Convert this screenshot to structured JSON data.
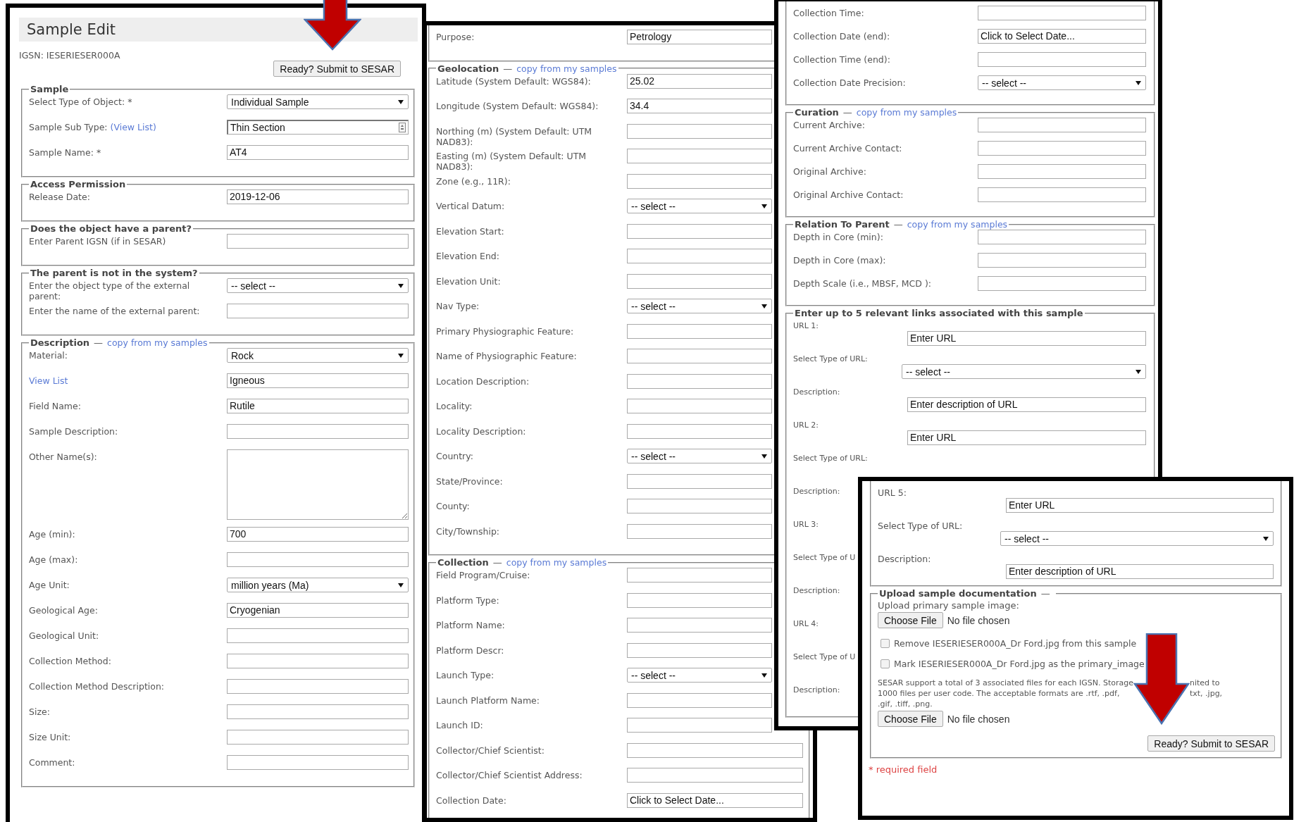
{
  "panels": [
    {
      "title": "Sample Edit",
      "igsn": "IGSN: IESERIESER000A",
      "submit": "Ready? Submit to SESAR",
      "sections": [
        {
          "kind": "form",
          "legend": "Sample",
          "rows": [
            {
              "kind": "select",
              "label": "Select Type of Object: *",
              "value": "Individual Sample"
            },
            {
              "kind": "lookup",
              "label": "Sample Sub Type:",
              "link": "(View List)",
              "value": "Thin Section"
            },
            {
              "kind": "input",
              "label": "Sample Name: *",
              "value": "AT4"
            }
          ]
        },
        {
          "kind": "form",
          "legend": "Access Permission",
          "rows": [
            {
              "kind": "input",
              "label": "Release Date:",
              "value": "2019-12-06"
            }
          ]
        },
        {
          "kind": "form",
          "legend": "Does the object have a parent?",
          "rows": [
            {
              "kind": "input",
              "label": "Enter Parent IGSN (if in SESAR)"
            }
          ]
        },
        {
          "kind": "form",
          "legend": "The parent is not in the system?",
          "rows": [
            {
              "kind": "select",
              "label": "Enter the object type of the external parent:",
              "value": "-- select --"
            },
            {
              "kind": "input",
              "label": "Enter the name of the external parent:"
            }
          ]
        },
        {
          "kind": "form",
          "legend": "Description",
          "separator": "—",
          "copy_link": "copy from my samples",
          "rows": [
            {
              "kind": "select",
              "label": "Material:",
              "value": "Rock"
            },
            {
              "kind": "input",
              "link": "View List",
              "value": "Igneous"
            },
            {
              "kind": "input",
              "label": "Field Name:",
              "value": "Rutile"
            },
            {
              "kind": "input",
              "label": "Sample Description:"
            },
            {
              "kind": "textarea",
              "label": "Other Name(s):"
            },
            {
              "kind": "input",
              "label": "Age (min):",
              "value": "700"
            },
            {
              "kind": "input",
              "label": "Age (max):"
            },
            {
              "kind": "select",
              "label": "Age Unit:",
              "value": "million years (Ma)"
            },
            {
              "kind": "input",
              "label": "Geological Age:",
              "value": "Cryogenian"
            },
            {
              "kind": "input",
              "label": "Geological Unit:"
            },
            {
              "kind": "input",
              "label": "Collection Method:"
            },
            {
              "kind": "input",
              "label": "Collection Method Description:"
            },
            {
              "kind": "input",
              "label": "Size:"
            },
            {
              "kind": "input",
              "label": "Size Unit:"
            },
            {
              "kind": "input",
              "label": "Comment:"
            }
          ]
        }
      ]
    },
    {
      "sections": [
        {
          "kind": "form",
          "rows": [
            {
              "kind": "input",
              "label": "Purpose:",
              "value": "Petrology"
            }
          ]
        },
        {
          "kind": "form",
          "legend": "Geolocation",
          "separator": "—",
          "copy_link": "copy from my samples",
          "rows": [
            {
              "kind": "input",
              "label": "Latitude (System Default: WGS84):",
              "value": "25.02"
            },
            {
              "kind": "input",
              "label": "Longitude (System Default: WGS84):",
              "value": "34.4"
            },
            {
              "kind": "input",
              "label": "Northing (m) (System Default: UTM NAD83):"
            },
            {
              "kind": "input",
              "label": "Easting (m) (System Default: UTM NAD83):"
            },
            {
              "kind": "input",
              "label": "Zone (e.g., 11R):"
            },
            {
              "kind": "select",
              "label": "Vertical Datum:",
              "value": "-- select --"
            },
            {
              "kind": "input",
              "label": "Elevation Start:"
            },
            {
              "kind": "input",
              "label": "Elevation End:"
            },
            {
              "kind": "input",
              "label": "Elevation Unit:"
            },
            {
              "kind": "select",
              "label": "Nav Type:",
              "value": "-- select --"
            },
            {
              "kind": "input",
              "label": "Primary Physiographic Feature:"
            },
            {
              "kind": "input",
              "label": "Name of Physiographic Feature:"
            },
            {
              "kind": "input",
              "label": "Location Description:"
            },
            {
              "kind": "input",
              "label": "Locality:"
            },
            {
              "kind": "input",
              "label": "Locality Description:"
            },
            {
              "kind": "select",
              "label": "Country:",
              "value": "-- select --"
            },
            {
              "kind": "input",
              "label": "State/Province:"
            },
            {
              "kind": "input",
              "label": "County:"
            },
            {
              "kind": "input",
              "label": "City/Township:"
            }
          ]
        },
        {
          "kind": "form",
          "legend": "Collection",
          "separator": "—",
          "copy_link": "copy from my samples",
          "rows": [
            {
              "kind": "input",
              "label": "Field Program/Cruise:"
            },
            {
              "kind": "input",
              "label": "Platform Type:"
            },
            {
              "kind": "input",
              "label": "Platform Name:"
            },
            {
              "kind": "input",
              "label": "Platform Descr:"
            },
            {
              "kind": "select",
              "label": "Launch Type:",
              "value": "-- select --"
            },
            {
              "kind": "input",
              "label": "Launch Platform Name:"
            },
            {
              "kind": "input",
              "label": "Launch ID:"
            },
            {
              "kind": "input",
              "label": "Collector/Chief Scientist:"
            },
            {
              "kind": "input",
              "label": "Collector/Chief Scientist Address:"
            },
            {
              "kind": "input",
              "label": "Collection Date:",
              "value": "Click to Select Date..."
            }
          ]
        }
      ]
    },
    {
      "sections": [
        {
          "kind": "form",
          "rows": [
            {
              "kind": "input",
              "label": "Collection Time:"
            },
            {
              "kind": "input",
              "label": "Collection Date (end):",
              "value": "Click to Select Date..."
            },
            {
              "kind": "input",
              "label": "Collection Time (end):"
            },
            {
              "kind": "select",
              "label": "Collection Date Precision:",
              "value": "-- select --"
            }
          ]
        },
        {
          "kind": "form",
          "legend": "Curation",
          "separator": "—",
          "copy_link": "copy from my samples",
          "rows": [
            {
              "kind": "input",
              "label": "Current Archive:"
            },
            {
              "kind": "input",
              "label": "Current Archive Contact:"
            },
            {
              "kind": "input",
              "label": "Original Archive:"
            },
            {
              "kind": "input",
              "label": "Original Archive Contact:"
            }
          ]
        },
        {
          "kind": "form",
          "legend": "Relation To Parent",
          "separator": "—",
          "copy_link": "copy from my samples",
          "rows": [
            {
              "kind": "input",
              "label": "Depth in Core (min):"
            },
            {
              "kind": "input",
              "label": "Depth in Core (max):"
            },
            {
              "kind": "input",
              "label": "Depth Scale (i.e., MBSF, MCD ):"
            }
          ]
        },
        {
          "kind": "links",
          "legend": "Enter up to 5 relevant links associated with this sample",
          "rows": [
            {
              "kind": "input",
              "label": "URL 1:",
              "value": "Enter URL"
            },
            {
              "kind": "select",
              "label": "Select Type of URL:",
              "value": "-- select --"
            },
            {
              "kind": "input",
              "label": "Description:",
              "value": "Enter description of URL"
            },
            {
              "kind": "input",
              "label": "URL 2:",
              "value": "Enter URL"
            },
            {
              "kind": "label",
              "label": "Select Type of URL:"
            },
            {
              "kind": "label",
              "label": "Description:"
            },
            {
              "kind": "label",
              "label": "URL 3:"
            },
            {
              "kind": "label",
              "label": "Select Type of U"
            },
            {
              "kind": "label",
              "label": "Description:"
            },
            {
              "kind": "label",
              "label": "URL 4:"
            },
            {
              "kind": "label",
              "label": "Select Type of U"
            },
            {
              "kind": "label",
              "label": "Description:"
            }
          ]
        }
      ]
    },
    {
      "required": "* required field",
      "sections": [
        {
          "kind": "links",
          "rows": [
            {
              "kind": "input",
              "label": "URL 5:",
              "value": "Enter URL"
            },
            {
              "kind": "select",
              "label": "Select Type of URL:",
              "value": "-- select --"
            },
            {
              "kind": "input",
              "label": "Description:",
              "value": "Enter description of URL"
            }
          ]
        },
        {
          "kind": "upload",
          "legend": "Upload sample documentation",
          "separator": "—",
          "rows": [
            {
              "kind": "text",
              "label": "Upload primary sample image:"
            },
            {
              "kind": "file",
              "button": "Choose File",
              "status": "No file chosen"
            },
            {
              "kind": "checkbox",
              "label": "Remove IESERIESER000A_Dr Ford.jpg from this sample",
              "checked": false
            },
            {
              "kind": "checkbox",
              "label": "Mark IESERIESER000A_Dr Ford.jpg as the primary_image",
              "checked": false
            },
            {
              "kind": "note",
              "lines": [
                [
                  "SESAR support a total of 3 associated files for each IGSN. Storage",
                  "nited to"
                ],
                [
                  "1000 files per user code. The acceptable formats are .rtf, .pdf,",
                  "txt, .jpg,"
                ],
                [
                  ".gif, .tiff, .png."
                ]
              ]
            },
            {
              "kind": "file",
              "button": "Choose File",
              "status": "No file chosen"
            },
            {
              "kind": "submit",
              "label": "Ready? Submit to SESAR"
            }
          ]
        }
      ]
    }
  ]
}
